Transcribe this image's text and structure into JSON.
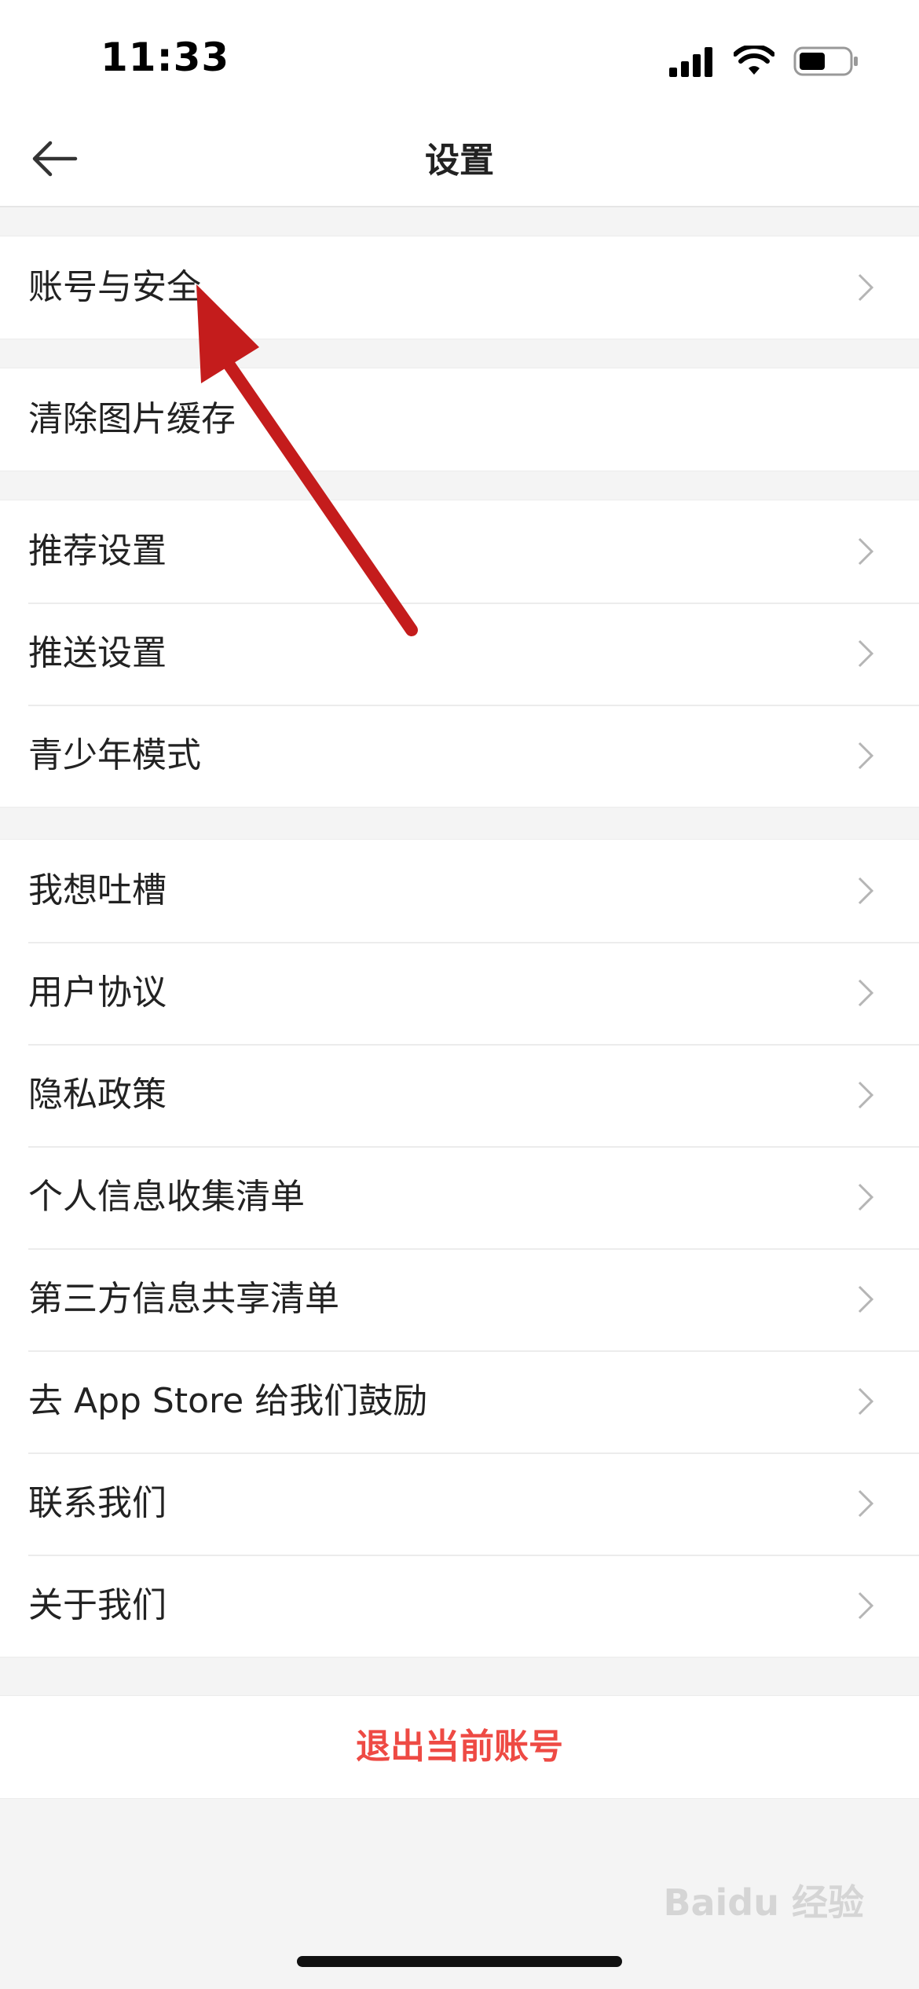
{
  "status_bar": {
    "time": "11:33"
  },
  "header": {
    "title": "设置"
  },
  "groups": [
    {
      "items": [
        {
          "label": "账号与安全"
        }
      ]
    },
    {
      "items": [
        {
          "label": "清除图片缓存"
        }
      ]
    },
    {
      "items": [
        {
          "label": "推荐设置"
        },
        {
          "label": "推送设置"
        },
        {
          "label": "青少年模式"
        }
      ]
    },
    {
      "items": [
        {
          "label": "我想吐槽"
        },
        {
          "label": "用户协议"
        },
        {
          "label": "隐私政策"
        },
        {
          "label": "个人信息收集清单"
        },
        {
          "label": "第三方信息共享清单"
        },
        {
          "label": "去 App Store 给我们鼓励"
        },
        {
          "label": "联系我们"
        },
        {
          "label": "关于我们"
        }
      ]
    }
  ],
  "logout": {
    "label": "退出当前账号"
  },
  "watermark": {
    "text": "Baidu 经验"
  },
  "colors": {
    "accent_red": "#ee4a44",
    "annotation_arrow": "#c41c1c"
  }
}
